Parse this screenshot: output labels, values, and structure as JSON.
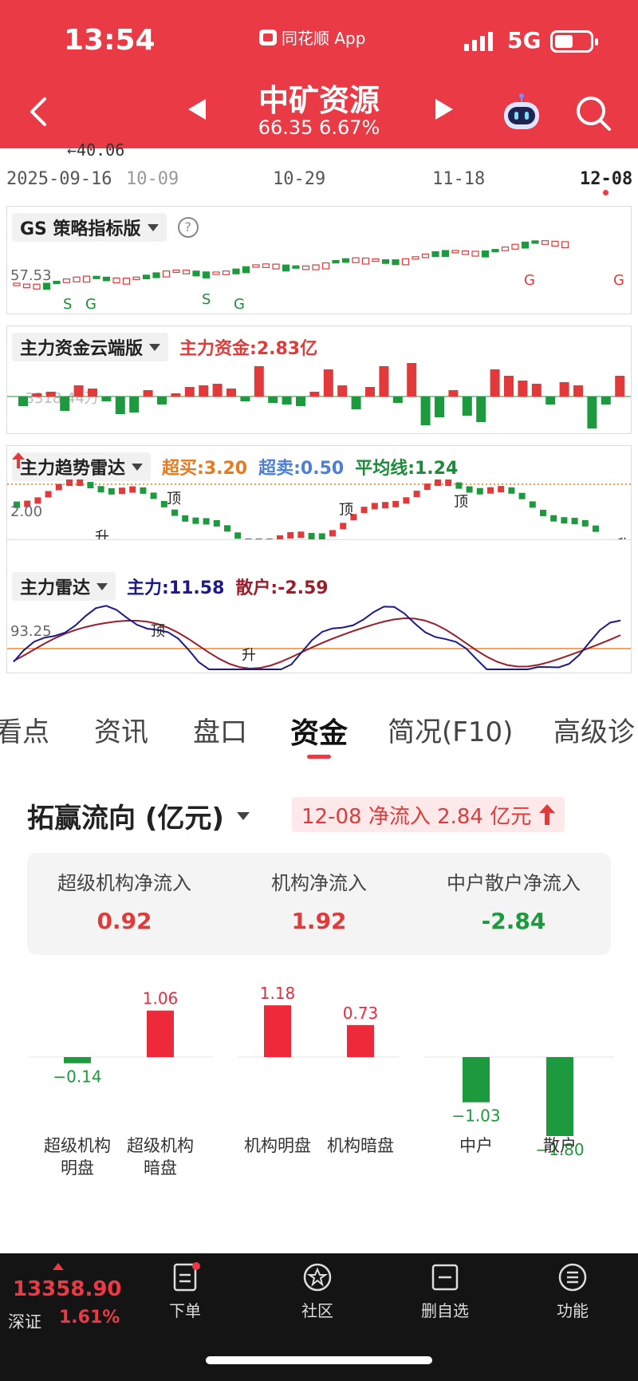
{
  "status": {
    "time": "13:54",
    "app": "同花顺 App",
    "network": "5G"
  },
  "header": {
    "title": "中矿资源",
    "price": "66.35",
    "change_pct": "6.67%"
  },
  "chart_dates": {
    "partial_top": "←40.06",
    "d1": "2025-09-16",
    "d2": "10-09",
    "d3": "10-29",
    "d4": "11-18",
    "d5": "12-08"
  },
  "panels": {
    "gs": {
      "name": "GS 策略指标版",
      "help": "?",
      "level": "57.53",
      "marks": [
        "S",
        "G",
        "S",
        "G",
        "G",
        "G"
      ]
    },
    "capital": {
      "name": "主力资金云端版",
      "value": "主力资金:2.83亿",
      "level": "-3318.44万"
    },
    "trend": {
      "name": "主力趋势雷达",
      "overbuy": "超买:3.20",
      "oversell": "超卖:0.50",
      "avg": "平均线:1.24",
      "level": "2.00",
      "tops": [
        "顶",
        "顶",
        "顶",
        "顶"
      ],
      "rises": [
        "升",
        "升"
      ]
    },
    "radar": {
      "name": "主力雷达",
      "main": "主力:11.58",
      "retail": "散户:-2.59",
      "level": "93.25",
      "top": "顶",
      "rise": "升"
    }
  },
  "tabs": [
    "看点",
    "资讯",
    "盘口",
    "资金",
    "简况(F10)",
    "高级诊"
  ],
  "active_tab": "资金",
  "flow": {
    "title": "拓赢流向 (亿元)",
    "badge": "12-08 净流入 2.84 亿元",
    "summary": [
      {
        "label": "超级机构净流入",
        "value": "0.92",
        "color": "red"
      },
      {
        "label": "机构净流入",
        "value": "1.92",
        "color": "red"
      },
      {
        "label": "中户散户净流入",
        "value": "-2.84",
        "color": "green"
      }
    ]
  },
  "chart_data": {
    "type": "bar",
    "categories": [
      "超级机构明盘",
      "超级机构暗盘",
      "机构明盘",
      "机构暗盘",
      "中户",
      "散户"
    ],
    "values": [
      -0.14,
      1.06,
      1.18,
      0.73,
      -1.03,
      -1.8
    ],
    "labels": [
      "−0.14",
      "1.06",
      "1.18",
      "0.73",
      "−1.03",
      "−1.80"
    ]
  },
  "bottom": {
    "index_value": "13358.90",
    "index_name": "深证",
    "index_pct": "1.61%",
    "nav": [
      {
        "label": "下单"
      },
      {
        "label": "社区"
      },
      {
        "label": "删自选"
      },
      {
        "label": "功能"
      }
    ]
  },
  "colors": {
    "brand_red": "#e93a45",
    "up": "#e23a3a",
    "down": "#1e9a3e"
  }
}
